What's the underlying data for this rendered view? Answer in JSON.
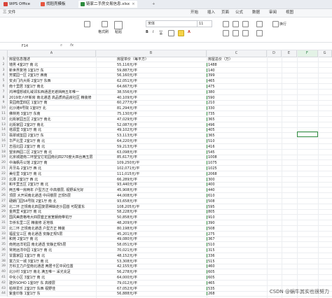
{
  "tabs": [
    {
      "label": "WPS Office",
      "color": "#d9443a"
    },
    {
      "label": "找稻壳模板",
      "color": "#e6553f"
    },
    {
      "label": "链家二手房交易信息.xlsx",
      "color": "#2e8b3e"
    }
  ],
  "menus": [
    "三 文件",
    "开始",
    "插入",
    "页面",
    "公式",
    "数据",
    "审阅",
    "视图"
  ],
  "active_menu": "开始",
  "ribbon": {
    "format_painter": "格式刷",
    "paste": "粘贴",
    "font_name": "宋体",
    "font_size": "11",
    "wrap": "换行"
  },
  "formula": {
    "cell_ref": "F14",
    "fx": "fx"
  },
  "columns": [
    "A",
    "B",
    "C",
    "D",
    "E",
    "F",
    "G"
  ],
  "selected_col": "F",
  "rows": [
    {
      "n": "1",
      "a": "房屋信息描述",
      "b": "房屋单价（每平方）",
      "c": "房屋总价（万）"
    },
    {
      "n": "2",
      "a": "墙男 4室2厅 南 北",
      "b": "55,116元/平",
      "c": "1488"
    },
    {
      "n": "3",
      "a": "新世界复地 1室1厅 东",
      "b": "59,887元/平",
      "c": "140"
    },
    {
      "n": "4",
      "a": "芳斌园一区 2室1厅 西南",
      "b": "56,160元/平",
      "c": "399"
    },
    {
      "n": "5",
      "a": "安贞门内大街 2室1厅 东西",
      "b": "62,051元/平",
      "c": "465"
    },
    {
      "n": "6",
      "a": "南十里居 3室1厅 南北",
      "b": "64,667元/平",
      "c": "475"
    },
    {
      "n": "7",
      "a": "鸿坤理想城礼域邻东西通透无遮挡两五年唯一",
      "b": "38,556元/平",
      "c": "380"
    },
    {
      "n": "8",
      "a": "2019年六环新房 南北通透 高品质商品房社区 精装修",
      "b": "40,109元/平",
      "c": "590"
    },
    {
      "n": "9",
      "a": "贵园南里四区 1室1厅 南",
      "b": "60,277元/平",
      "c": "210"
    },
    {
      "n": "10",
      "a": "北沙滩4号院 1室0厅 北",
      "b": "81,294元/平",
      "c": "330"
    },
    {
      "n": "11",
      "a": "佛林苑 3室1厅 东南",
      "b": "75,130元/平",
      "c": "735"
    },
    {
      "n": "12",
      "a": "北街家园五区 2室1厅 南北",
      "b": "47,029元/平",
      "c": "365"
    },
    {
      "n": "13",
      "a": "北街家园 2室2厅 南北",
      "b": "52,087元/平",
      "c": "496"
    },
    {
      "n": "14",
      "a": "塔源里 3室1厅 南 北",
      "b": "49,102元/平",
      "c": "405"
    },
    {
      "n": "15",
      "a": "翡翠城玺园 2室1厅 东",
      "b": "53,113元/平",
      "c": "365"
    },
    {
      "n": "16",
      "a": "华严北里 2室1厅 南 北",
      "b": "64,220元/平",
      "c": "510"
    },
    {
      "n": "17",
      "a": "志强北园 2室1厅 南 北",
      "b": "59,213元/平",
      "c": "416"
    },
    {
      "n": "18",
      "a": "望京西园二区 2室1厅 南 北",
      "b": "63,098元/平",
      "c": "545"
    },
    {
      "n": "19",
      "a": "北京城建南二环望宝它花园南北四270度大四台两五层",
      "b": "85,617元/平",
      "c": "1008"
    },
    {
      "n": "20",
      "a": "中海枫丹公馆 2室2厅 南",
      "b": "109,250元/平",
      "c": "1075"
    },
    {
      "n": "21",
      "a": "月牙岛 2室1厅 西 北",
      "b": "102,071元/平",
      "c": "1025"
    },
    {
      "n": "22",
      "a": "美伦里 3室1厅 南 北",
      "b": "111,015元/平",
      "c": "2068"
    },
    {
      "n": "23",
      "a": "北潭 2室1厅 西 北",
      "b": "66,289元/平",
      "c": "300"
    },
    {
      "n": "24",
      "a": "和平里五区 2室1厅 南 北",
      "b": "93,440元/平",
      "c": "400"
    },
    {
      "n": "25",
      "a": "两五唯一房两年 户型方正 中高楼层, 视野采光好",
      "b": "45,908元/平",
      "c": "440"
    },
    {
      "n": "26",
      "a": "顶层 大开间南北通透 中间楼层 正规5层",
      "b": "44,008元/平",
      "c": "610"
    },
    {
      "n": "27",
      "a": "硬朗门园54号院 2室1厅 南 北",
      "b": "93,658元/平",
      "c": "508"
    },
    {
      "n": "28",
      "a": "北二环 正规南北四园复层稀缺走沙园首 可配置东",
      "b": "108,205元/平",
      "c": "595"
    },
    {
      "n": "29",
      "a": "金燕里 4室2厅 南 北",
      "b": "58,228元/平",
      "c": "805"
    },
    {
      "n": "30",
      "a": "国风美唐格电大四层套正宫宽朝南带花厅",
      "b": "50,858元/平",
      "c": "910"
    },
    {
      "n": "31",
      "a": "华侨东里二区 精装修 近地铁",
      "b": "48,209元/平",
      "c": "390"
    },
    {
      "n": "32",
      "a": "北二环 正规南北通透 户型方正 精装",
      "b": "80,198元/平",
      "c": "508"
    },
    {
      "n": "33",
      "a": "福星宝三区 南北通透 安静正规5层",
      "b": "45,201元/平",
      "c": "275"
    },
    {
      "n": "34",
      "a": "和苑 2室1厅 南 北",
      "b": "49,080元/平",
      "c": "367"
    },
    {
      "n": "35",
      "a": "南苑远洋花园 南北通透 安静正规5层",
      "b": "58,051元/平",
      "c": "510"
    },
    {
      "n": "36",
      "a": "常苑远洋中园 1室1厅 南 北",
      "b": "70,021元/平",
      "c": "315"
    },
    {
      "n": "37",
      "a": "甘露家园 1室1厅 南 北",
      "b": "48,152元/平",
      "c": "336"
    },
    {
      "n": "38",
      "a": "富力又一城 3室1厅 南 北",
      "b": "53,308元/平",
      "c": "515"
    },
    {
      "n": "39",
      "a": "方科主力户型南北通透 两居卡区中间位置",
      "b": "42,155元/平",
      "c": "460"
    },
    {
      "n": "40",
      "a": "北沙村 3室1厅 南北 满五唯一 采光充足",
      "b": "56,278元/平",
      "c": "605"
    },
    {
      "n": "41",
      "a": "中化小区 3室1厅 南 北",
      "b": "64,000元/平",
      "c": "605"
    },
    {
      "n": "42",
      "a": "建外SOHO 1室0厅 东 高楼层",
      "b": "79,012元/平",
      "c": "465"
    },
    {
      "n": "43",
      "a": "柏林爱乐 2室2厅 东西 视野佳",
      "b": "67,052元/平",
      "c": "535"
    },
    {
      "n": "44",
      "a": "紫金印象 1室1厅 东",
      "b": "56,888元/平",
      "c": "268"
    }
  ],
  "watermark": "CSDN @蜗牛其实也很努力"
}
